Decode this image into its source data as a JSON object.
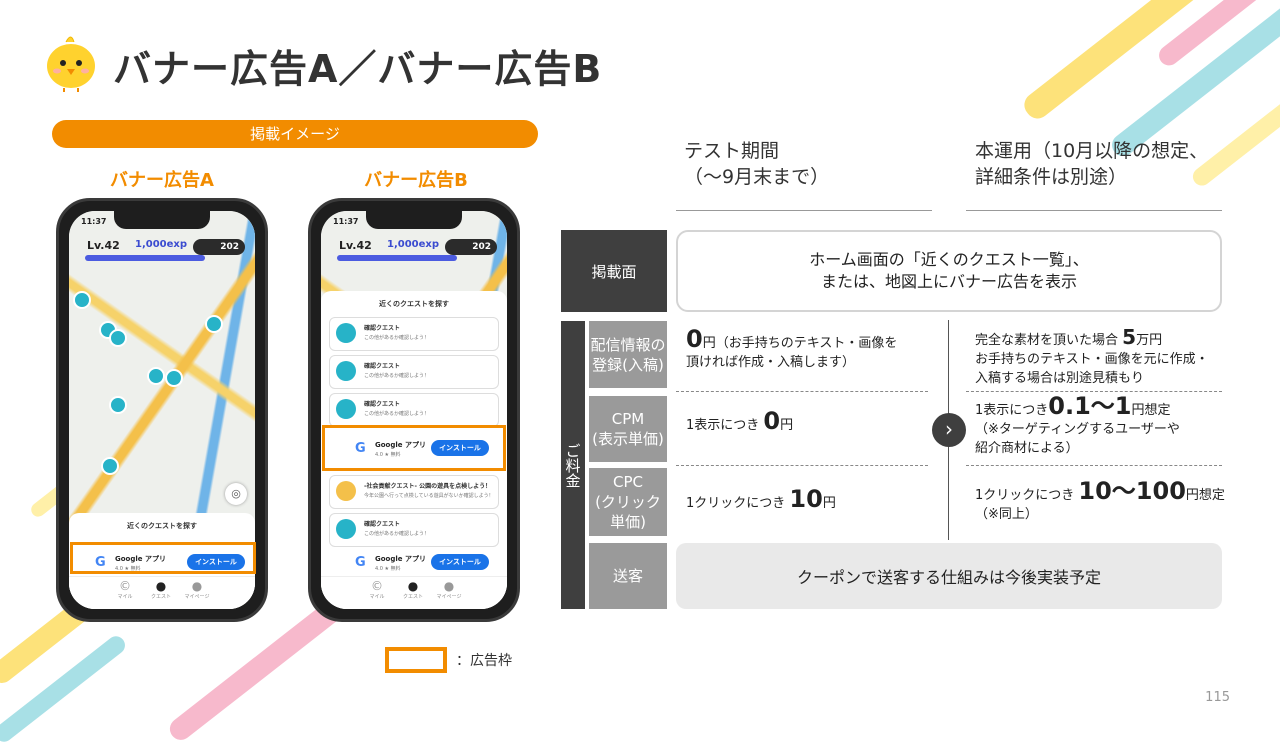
{
  "title": "バナー広告A／バナー広告B",
  "image_section": {
    "label": "掲載イメージ",
    "phone_a_label": "バナー広告A",
    "phone_b_label": "バナー広告B"
  },
  "phone": {
    "time": "11:37",
    "level": "Lv.42",
    "exp": "1,000exp",
    "coins": "202",
    "sheet_title": "近くのクエストを探す",
    "quests": [
      {
        "title": "確認クエスト",
        "sub": "この他があるか確認しよう！"
      },
      {
        "title": "確認クエスト",
        "sub": "この他があるか確認しよう！"
      },
      {
        "title": "確認クエスト",
        "sub": "この他があるか確認しよう！"
      },
      {
        "title": "-社会貢献クエスト- 公園の遊具を点検しよう！",
        "sub": "今年公園へ行って点検している遊具がないか確認しよう！"
      },
      {
        "title": "確認クエスト",
        "sub": "この他があるか確認しよう！"
      }
    ],
    "ad": {
      "app_name": "Google アプリ",
      "rating": "4.0 ★ 無料",
      "install_label": "インストール"
    },
    "tabs": [
      "マイル",
      "クエスト",
      "マイページ"
    ]
  },
  "legend": "：広告枠",
  "columns": {
    "test": "テスト期間\n（〜9月末まで）",
    "prod": "本運用（10月以降の想定、\n詳細条件は別途）"
  },
  "rows": {
    "placement": {
      "head": "掲載面",
      "text": "ホーム画面の「近くのクエスト一覧」、\nまたは、地図上にバナー広告を表示"
    },
    "fee_label": "ご料金",
    "registration": {
      "head": "配信情報の\n登録(入稿)",
      "test_big": "0",
      "test_text": "円（お手持ちのテキスト・画像を\n頂ければ作成・入稿します）",
      "prod_line1_pre": "完全な素材を頂いた場合 ",
      "prod_big": "5",
      "prod_line1_post": "万円",
      "prod_line2": "お手持ちのテキスト・画像を元に作成・\n入稿する場合は別途見積もり"
    },
    "cpm": {
      "head": "CPM\n(表示単価)",
      "test_pre": "1表示につき ",
      "test_big": "0",
      "test_post": "円",
      "prod_pre": "1表示につき",
      "prod_big": "0.1〜1",
      "prod_post": "円想定",
      "prod_note": "（※ターゲティングするユーザーや\n紹介商材による）"
    },
    "cpc": {
      "head": "CPC\n(クリック単価)",
      "test_pre": "1クリックにつき ",
      "test_big": "10",
      "test_post": "円",
      "prod_pre": "1クリックにつき ",
      "prod_big": "10〜100",
      "prod_post": "円想定",
      "prod_note": "（※同上）"
    },
    "customer": {
      "head": "送客",
      "text": "クーポンで送客する仕組みは今後実装予定"
    }
  },
  "page_number": "115",
  "colors": {
    "accent": "#f28c00",
    "dark": "#3f3f3f",
    "mid": "#9a9a9a"
  }
}
